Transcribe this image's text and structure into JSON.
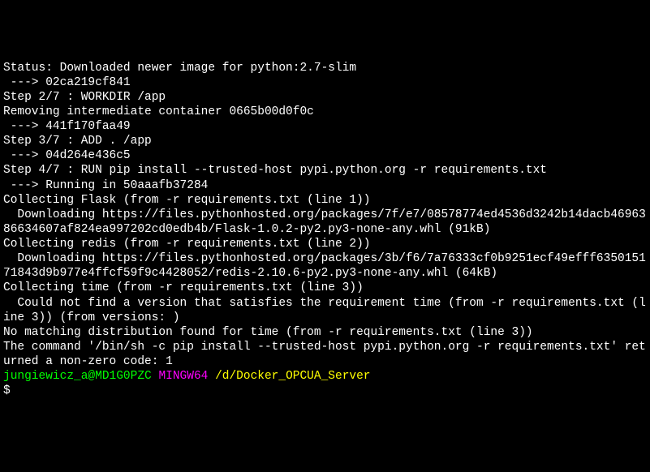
{
  "lines": {
    "l0": "Status: Downloaded newer image for python:2.7-slim",
    "l1": " ---> 02ca219cf841",
    "l2": "Step 2/7 : WORKDIR /app",
    "l3": "Removing intermediate container 0665b00d0f0c",
    "l4": " ---> 441f170faa49",
    "l5": "Step 3/7 : ADD . /app",
    "l6": " ---> 04d264e436c5",
    "l7": "Step 4/7 : RUN pip install --trusted-host pypi.python.org -r requirements.txt",
    "l8": " ---> Running in 50aaafb37284",
    "l9": "Collecting Flask (from -r requirements.txt (line 1))",
    "l10": "  Downloading https://files.pythonhosted.org/packages/7f/e7/08578774ed4536d3242b14dacb4696386634607af824ea997202cd0edb4b/Flask-1.0.2-py2.py3-none-any.whl (91kB)",
    "l11": "Collecting redis (from -r requirements.txt (line 2))",
    "l12": "  Downloading https://files.pythonhosted.org/packages/3b/f6/7a76333cf0b9251ecf49efff635015171843d9b977e4ffcf59f9c4428052/redis-2.10.6-py2.py3-none-any.whl (64kB)",
    "l13": "Collecting time (from -r requirements.txt (line 3))",
    "l14": "  Could not find a version that satisfies the requirement time (from -r requirements.txt (line 3)) (from versions: )",
    "l15": "No matching distribution found for time (from -r requirements.txt (line 3))",
    "l16": "The command '/bin/sh -c pip install --trusted-host pypi.python.org -r requirements.txt' returned a non-zero code: 1",
    "l17": ""
  },
  "prompt": {
    "user": "jungiewicz_a@MD1G0PZC",
    "mingw": "MINGW64",
    "path": "/d/Docker_OPCUA_Server",
    "cursor": "$"
  }
}
